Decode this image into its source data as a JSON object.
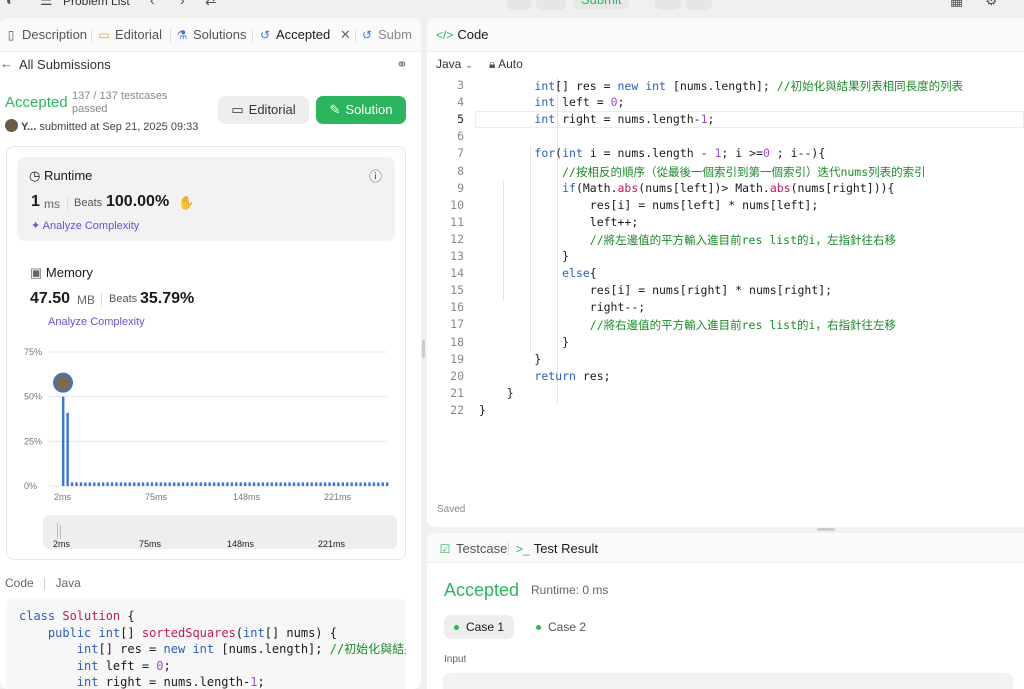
{
  "topbar": {
    "problem_list": "Problem List",
    "submit": "Submit"
  },
  "tabs": [
    {
      "label": "Description",
      "icon": "document-icon"
    },
    {
      "label": "Editorial",
      "icon": "book-icon"
    },
    {
      "label": "Solutions",
      "icon": "flask-icon"
    },
    {
      "label": "Accepted",
      "icon": "history-icon"
    },
    {
      "label": "Subm",
      "icon": "history-icon"
    }
  ],
  "submission": {
    "back_label": "All Submissions",
    "status": "Accepted",
    "testcases": "137 / 137 testcases passed",
    "user": "Y...",
    "submitted_at": "submitted at Sep 21, 2025 09:33",
    "editorial_btn": "Editorial",
    "solution_btn": "Solution"
  },
  "runtime": {
    "title": "Runtime",
    "value": "1",
    "unit": "ms",
    "beats_label": "Beats",
    "beats": "100.00%",
    "analyze": "Analyze Complexity"
  },
  "memory": {
    "title": "Memory",
    "value": "47.50",
    "unit": "MB",
    "beats_label": "Beats",
    "beats": "35.79%",
    "analyze": "Analyze Complexity"
  },
  "chart_data": {
    "type": "bar",
    "y_ticks": [
      "75%",
      "50%",
      "25%",
      "0%"
    ],
    "x_ticks": [
      "2ms",
      "75ms",
      "148ms",
      "221ms"
    ],
    "ylim": [
      0,
      75
    ],
    "values": [
      50,
      41,
      2,
      2,
      2,
      2,
      2,
      2,
      2,
      2,
      2,
      2,
      2,
      2,
      2,
      2,
      2,
      2,
      2,
      2,
      2,
      2,
      2,
      2,
      2,
      2,
      2,
      2,
      2,
      2,
      2,
      2,
      2,
      2,
      2,
      2,
      2,
      2,
      2,
      2,
      2,
      2,
      2,
      2,
      2,
      2,
      2,
      2,
      2,
      2,
      2,
      2,
      2,
      2,
      2,
      2,
      2,
      2,
      2,
      2,
      2,
      2,
      2,
      2,
      2,
      2,
      2,
      2,
      2,
      2,
      2,
      2,
      2,
      2
    ],
    "bar_color": "#3b73e0",
    "grid": true
  },
  "minimap": {
    "x_ticks": [
      "2ms",
      "75ms",
      "148ms",
      "221ms"
    ]
  },
  "code_preview": {
    "header_code": "Code",
    "header_lang": "Java",
    "lines": [
      "class Solution {",
      "    public int[] sortedSquares(int[] nums) {",
      "        int[] res = new int [nums.length]; //初始化與結果列",
      "        int left = 0;",
      "        int right = nums.length-1;"
    ]
  },
  "editor": {
    "title": "Code",
    "language": "Java",
    "mode": "Auto",
    "saved": "Saved",
    "start_line": 3,
    "active_line": 5,
    "lines": [
      "        int[] res = new int [nums.length]; //初始化與結果列表相同長度的列表",
      "        int left = 0;",
      "        int right = nums.length-1;",
      "",
      "        for(int i = nums.length - 1; i >=0 ; i--){",
      "            //按相反的順序（從最後一個索引到第一個索引）迭代nums列表的索引",
      "            if(Math.abs(nums[left])> Math.abs(nums[right])){",
      "                res[i] = nums[left] * nums[left];",
      "                left++;",
      "                //將左邊值的平方輸入進目前res list的i，左指針往右移",
      "            }",
      "            else{",
      "                res[i] = nums[right] * nums[right];",
      "                right--;",
      "                //將右邊值的平方輸入進目前res list的i，右指針往左移",
      "            }",
      "        }",
      "        return res;",
      "    }",
      "}"
    ]
  },
  "result": {
    "tab_testcase": "Testcase",
    "tab_result": "Test Result",
    "status": "Accepted",
    "runtime": "Runtime: 0 ms",
    "cases": [
      "Case 1",
      "Case 2"
    ],
    "input_label": "Input"
  }
}
